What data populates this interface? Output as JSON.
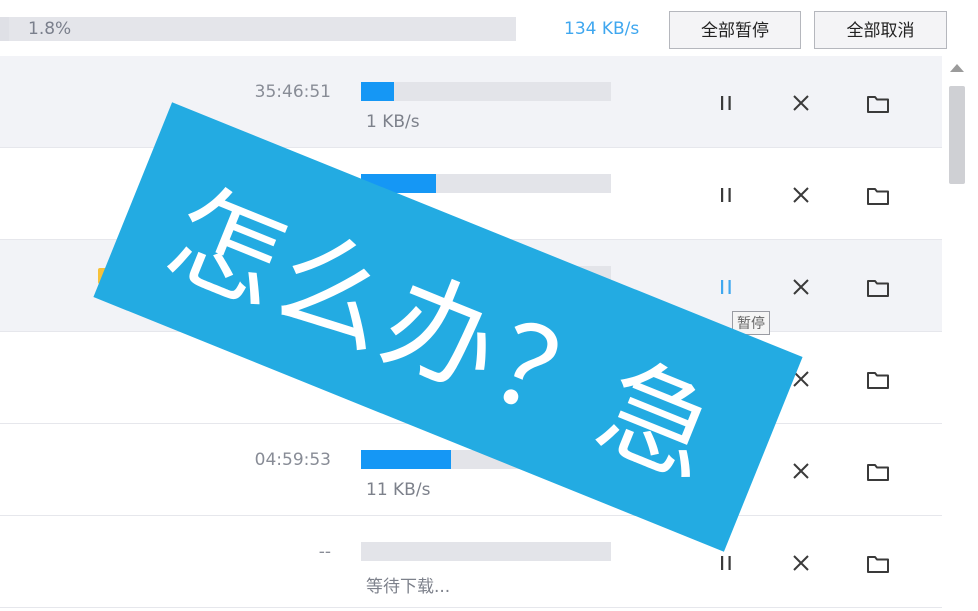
{
  "header": {
    "total_progress_text": "1.8%",
    "total_progress_fraction": 0.018,
    "total_speed": "134 KB/s",
    "pause_all_label": "全部暂停",
    "cancel_all_label": "全部取消"
  },
  "downloads": [
    {
      "time": "35:46:51",
      "progress": 0.13,
      "speed": "1 KB/s"
    },
    {
      "time": "",
      "progress": 0.3,
      "speed": ""
    },
    {
      "time": "",
      "progress": 0.0,
      "speed": ""
    },
    {
      "time": "",
      "progress": 0.0,
      "speed": ""
    },
    {
      "time": "04:59:53",
      "progress": 0.36,
      "speed": "11 KB/s"
    },
    {
      "time": "--",
      "progress": 0.0,
      "speed": "等待下载..."
    }
  ],
  "tooltip": "暂停",
  "overlay_text": "怎么办？急",
  "icons": {
    "pause": "pause-icon",
    "cancel": "close-icon",
    "folder": "folder-icon"
  },
  "colors": {
    "accent": "#1597f5",
    "speed_text": "#3fa7ef",
    "banner": "#23abe2"
  }
}
